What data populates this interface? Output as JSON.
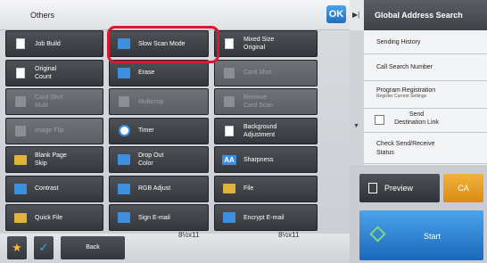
{
  "header": {
    "title": "Others",
    "ok_label": "OK"
  },
  "grid": {
    "rows": [
      [
        {
          "label": "Job Build",
          "icon": "job-build-icon",
          "enabled": true
        },
        {
          "label": "Slow Scan Mode",
          "icon": "slow-scan-icon",
          "enabled": true
        },
        {
          "label": "Mixed Size\nOriginal",
          "icon": "mixed-size-icon",
          "enabled": true
        }
      ],
      [
        {
          "label": "Original\nCount",
          "icon": "original-count-icon",
          "enabled": true
        },
        {
          "label": "Erase",
          "icon": "erase-icon",
          "enabled": true
        },
        {
          "label": "Card Shot",
          "icon": "card-shot-icon",
          "enabled": false
        }
      ],
      [
        {
          "label": "Card Shot\nMulti",
          "icon": "card-shot-multi-icon",
          "enabled": false
        },
        {
          "label": "Multicrop",
          "icon": "multicrop-icon",
          "enabled": false
        },
        {
          "label": "Remove\nCard Scan",
          "icon": "remove-card-scan-icon",
          "enabled": false
        }
      ],
      [
        {
          "label": "Image Flip",
          "icon": "image-flip-icon",
          "enabled": false
        },
        {
          "label": "Timer",
          "icon": "timer-icon",
          "enabled": true
        },
        {
          "label": "Background\nAdjustment",
          "icon": "background-adjustment-icon",
          "enabled": true
        }
      ],
      [
        {
          "label": "Blank Page\nSkip",
          "icon": "blank-page-skip-icon",
          "enabled": true
        },
        {
          "label": "Drop Out\nColor",
          "icon": "drop-out-color-icon",
          "enabled": true
        },
        {
          "label": "Sharpness",
          "icon": "sharpness-icon",
          "enabled": true
        }
      ],
      [
        {
          "label": "Contrast",
          "icon": "contrast-icon",
          "enabled": true
        },
        {
          "label": "RGB Adjust",
          "icon": "rgb-adjust-icon",
          "enabled": true
        },
        {
          "label": "File",
          "icon": "file-icon",
          "enabled": true
        }
      ],
      [
        {
          "label": "Quick File",
          "icon": "quick-file-icon",
          "enabled": true
        },
        {
          "label": "Sign E-mail",
          "icon": "sign-email-icon",
          "enabled": true
        },
        {
          "label": "Encrypt E-mail",
          "icon": "encrypt-email-icon",
          "enabled": true
        }
      ]
    ]
  },
  "right_panel": {
    "title": "Global Address Search",
    "items": [
      "Sending History",
      "Call Search Number"
    ],
    "program_registration": {
      "label": "Program Registration",
      "sub": "Register Current Settings"
    },
    "send_destination_link": "Send\nDestination Link",
    "check_send_receive": "Check Send/Receive\nStatus"
  },
  "actions": {
    "preview": "Preview",
    "ca": "CA",
    "start": "Start"
  },
  "bottom": {
    "back": "Back",
    "paper_sizes": [
      "8½x11",
      "8½x11"
    ]
  },
  "colors": {
    "accent": "#1e6fc2",
    "highlight": "#d8182d",
    "ca": "#e9a021"
  }
}
